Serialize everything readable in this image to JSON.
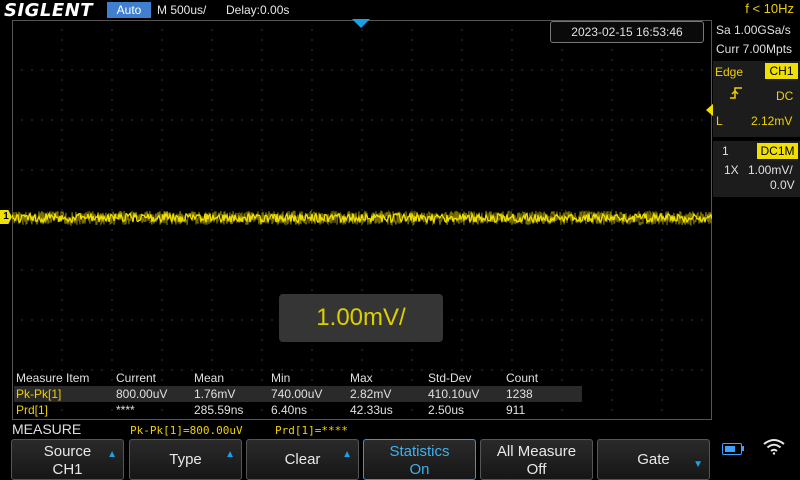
{
  "brand": "SIGLENT",
  "acq_mode": "Auto",
  "timebase": "M 500us/",
  "delay": "Delay:0.00s",
  "frequency": "f < 10Hz",
  "timestamp": "2023-02-15 16:53:46",
  "sample_rate": "Sa 1.00GSa/s",
  "memory_depth": "Curr 7.00Mpts",
  "trigger": {
    "type": "Edge",
    "source": "CH1",
    "coupling": "DC",
    "level_label": "L",
    "level_value": "2.12mV"
  },
  "channel": {
    "number": "1",
    "coupling": "DC1M",
    "probe": "1X",
    "scale": "1.00mV/",
    "offset": "0.0V",
    "marker": "1"
  },
  "scale_popup": "1.00mV/",
  "measure_table": {
    "headers": [
      "Measure Item",
      "Current",
      "Mean",
      "Min",
      "Max",
      "Std-Dev",
      "Count"
    ],
    "rows": [
      [
        "Pk-Pk[1]",
        "800.00uV",
        "1.76mV",
        "740.00uV",
        "2.82mV",
        "410.10uV",
        "1238"
      ],
      [
        "Prd[1]",
        "****",
        "285.59ns",
        "6.40ns",
        "42.33us",
        "2.50us",
        "911"
      ]
    ]
  },
  "measure_bar": {
    "title": "MEASURE",
    "readout1": "Pk-Pk[1]=800.00uV",
    "readout2": "Prd[1]=****"
  },
  "softkeys": {
    "source": {
      "line1": "Source",
      "line2": "CH1"
    },
    "type": {
      "label": "Type"
    },
    "clear": {
      "label": "Clear"
    },
    "statistics": {
      "line1": "Statistics",
      "line2": "On"
    },
    "all_measure": {
      "line1": "All Measure",
      "line2": "Off"
    },
    "gate": {
      "label": "Gate"
    }
  },
  "colors": {
    "channel1": "#f0e000",
    "accent": "#1aa0e6",
    "mode_badge": "#3f7fd0"
  },
  "icons": [
    "trigger-position-icon",
    "rising-edge-icon",
    "battery-icon",
    "wifi-icon"
  ]
}
